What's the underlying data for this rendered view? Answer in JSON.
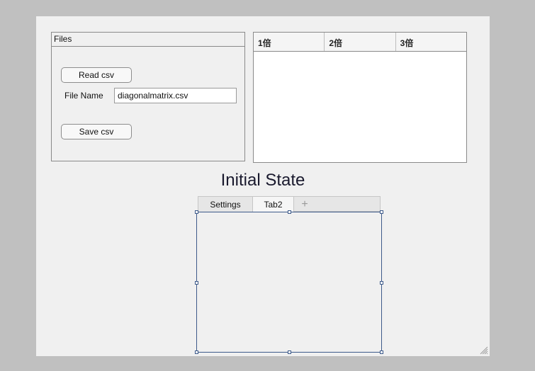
{
  "files_panel": {
    "title": "Files",
    "read_button": "Read csv",
    "file_name_label": "File Name",
    "file_name_value": "diagonalmatrix.csv",
    "save_button": "Save csv"
  },
  "table": {
    "columns": [
      "1倍",
      "2倍",
      "3倍"
    ],
    "rows": []
  },
  "state_label": "Initial State",
  "tabs": {
    "items": [
      "Settings",
      "Tab2"
    ],
    "active_index": 1,
    "add_symbol": "+"
  }
}
